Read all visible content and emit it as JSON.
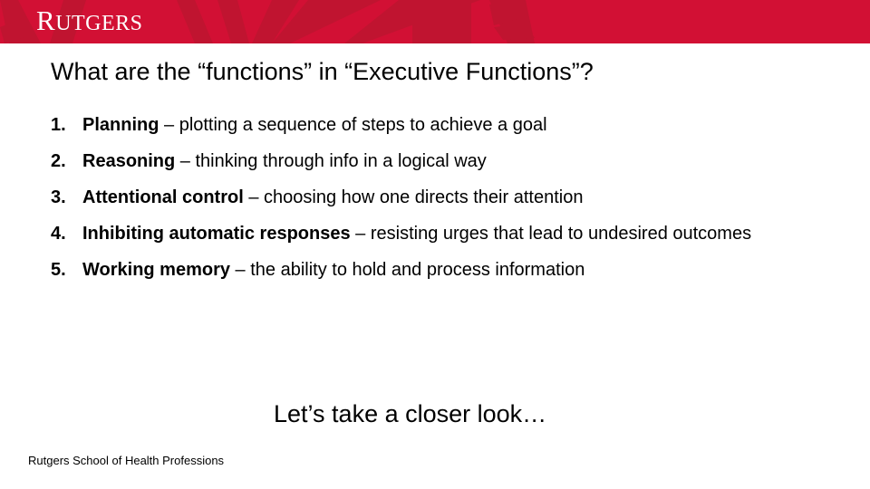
{
  "header": {
    "logo_first_letter": "R",
    "logo_rest": "UTGERS",
    "colors": {
      "brand_red": "#d21034",
      "ray_red": "#bd1530",
      "logo_text": "#ffffff"
    }
  },
  "slide": {
    "title": "What are the “functions” in “Executive Functions”?",
    "items": [
      {
        "number": "1.",
        "term": "Planning",
        "description": " – plotting a sequence of steps to achieve a goal"
      },
      {
        "number": "2.",
        "term": "Reasoning",
        "description": " – thinking through info in a logical way"
      },
      {
        "number": "3.",
        "term": "Attentional control",
        "description": " – choosing how one directs their attention"
      },
      {
        "number": "4.",
        "term": "Inhibiting automatic responses",
        "description": " – resisting urges that lead to undesired outcomes"
      },
      {
        "number": "5.",
        "term": "Working memory",
        "description": " – the ability to hold and process information"
      }
    ],
    "closing": "Let’s take a closer look…"
  },
  "footer": {
    "text": "Rutgers School of Health Professions"
  }
}
